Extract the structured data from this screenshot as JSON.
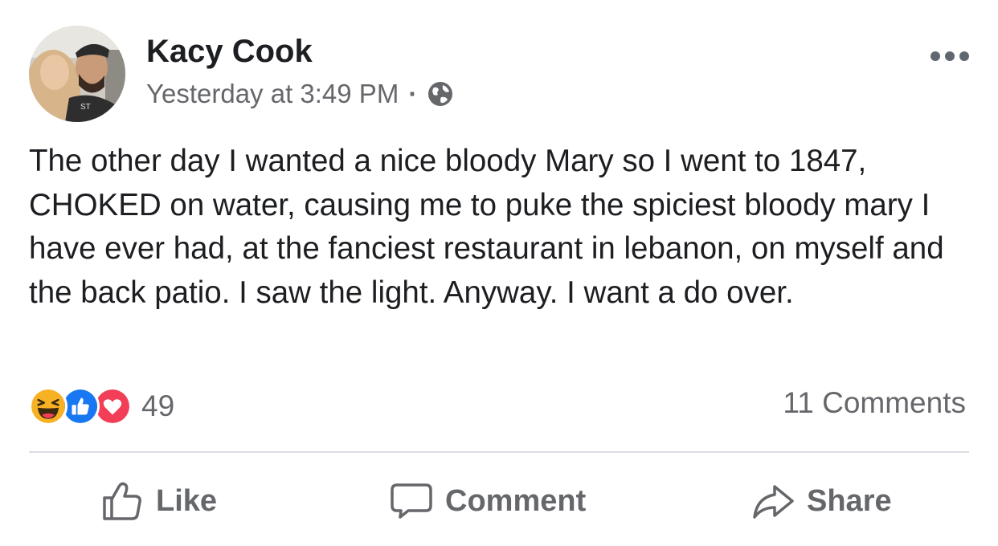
{
  "post": {
    "author": "Kacy Cook",
    "timestamp": "Yesterday at 3:49 PM",
    "separator": "·",
    "privacy_icon": "globe-icon",
    "body": "The other day I wanted a nice bloody Mary so I went to 1847, CHOKED on water, causing me to puke the spiciest bloody mary I have ever had, at the fanciest restaurant in lebanon, on myself and the back patio. I saw the light. Anyway. I want a do over.",
    "more_icon": "more-options-icon"
  },
  "reactions": {
    "icons": [
      "haha-reaction-icon",
      "like-reaction-icon",
      "love-reaction-icon"
    ],
    "count": "49",
    "comments": "11 Comments"
  },
  "actions": {
    "like": "Like",
    "comment": "Comment",
    "share": "Share"
  },
  "colors": {
    "text": "#1c1e21",
    "secondary": "#65676b",
    "like_blue": "#1877f2",
    "love_red": "#f33e58",
    "haha_yellow": "#f7b125"
  }
}
